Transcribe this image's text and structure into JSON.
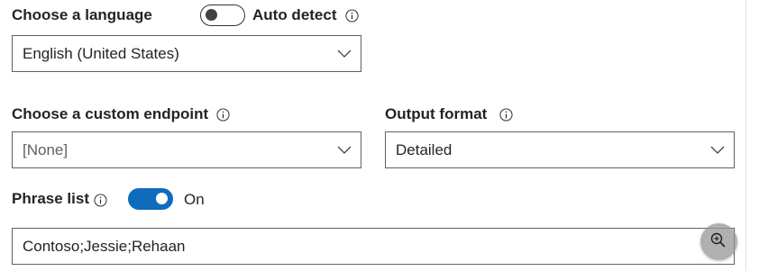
{
  "language": {
    "label": "Choose a language",
    "auto_detect": {
      "label": "Auto detect",
      "state": "off"
    },
    "selected": "English (United States)"
  },
  "custom_endpoint": {
    "label": "Choose a custom endpoint",
    "selected": "[None]"
  },
  "output_format": {
    "label": "Output format",
    "selected": "Detailed"
  },
  "phrase_list": {
    "label": "Phrase list",
    "toggle_state_text": "On",
    "value": "Contoso;Jessie;Rehaan"
  },
  "icons": {
    "info": "info-icon",
    "chevron": "chevron-down-icon",
    "zoom": "zoom-in-icon"
  },
  "colors": {
    "accent": "#0f6cbd",
    "text": "#242424",
    "border": "#616161"
  }
}
